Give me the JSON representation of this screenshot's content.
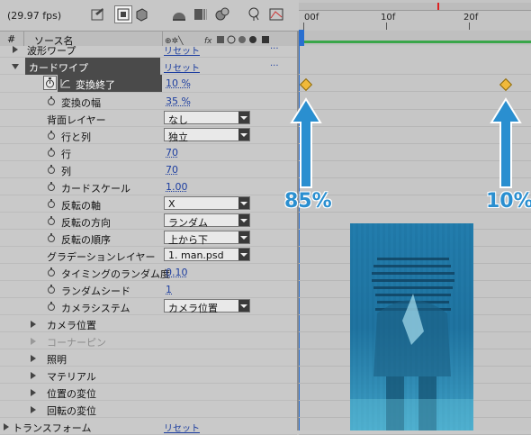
{
  "toolbar": {
    "fps": "(29.97 fps)",
    "icons": [
      "comp-settings-icon",
      "draft-3d-icon",
      "hide-shy-icon",
      "frame-blending-icon",
      "motion-blur-icon",
      "graph-editor-icon",
      "live-update-icon"
    ]
  },
  "panel": {
    "hash_label": "#",
    "source_name_label": "ソース名"
  },
  "rows": [
    {
      "label": "波形ワープ",
      "reset": "リセット",
      "dots": "..."
    },
    {
      "label": "カードワイプ",
      "reset": "リセット",
      "dots": "..."
    },
    {
      "label": "変換終了",
      "value": "10 %"
    },
    {
      "label": "変換の幅",
      "value": "35 %"
    },
    {
      "label": "背面レイヤー",
      "select": "なし"
    },
    {
      "label": "行と列",
      "select": "独立"
    },
    {
      "label": "行",
      "value": "70"
    },
    {
      "label": "列",
      "value": "70"
    },
    {
      "label": "カードスケール",
      "value": "1.00"
    },
    {
      "label": "反転の軸",
      "select": "X"
    },
    {
      "label": "反転の方向",
      "select": "ランダム"
    },
    {
      "label": "反転の順序",
      "select": "上から下"
    },
    {
      "label": "グラデーションレイヤー",
      "select": "1. man.psd"
    },
    {
      "label": "タイミングのランダム度",
      "value": "0.10"
    },
    {
      "label": "ランダムシード",
      "value": "1"
    },
    {
      "label": "カメラシステム",
      "select": "カメラ位置"
    },
    {
      "label": "カメラ位置"
    },
    {
      "label": "コーナーピン"
    },
    {
      "label": "照明"
    },
    {
      "label": "マテリアル"
    },
    {
      "label": "位置の変位"
    },
    {
      "label": "回転の変位"
    },
    {
      "label": "トランスフォーム",
      "reset": "リセット"
    }
  ],
  "timeline": {
    "ruler_labels": [
      "00f",
      "10f",
      "20f"
    ]
  },
  "annotations": {
    "left_pct": "85%",
    "right_pct": "10%"
  },
  "colors": {
    "accent": "#2a8fd0",
    "keyframe": "#f0b93a",
    "work_area": "#3aa64a"
  }
}
